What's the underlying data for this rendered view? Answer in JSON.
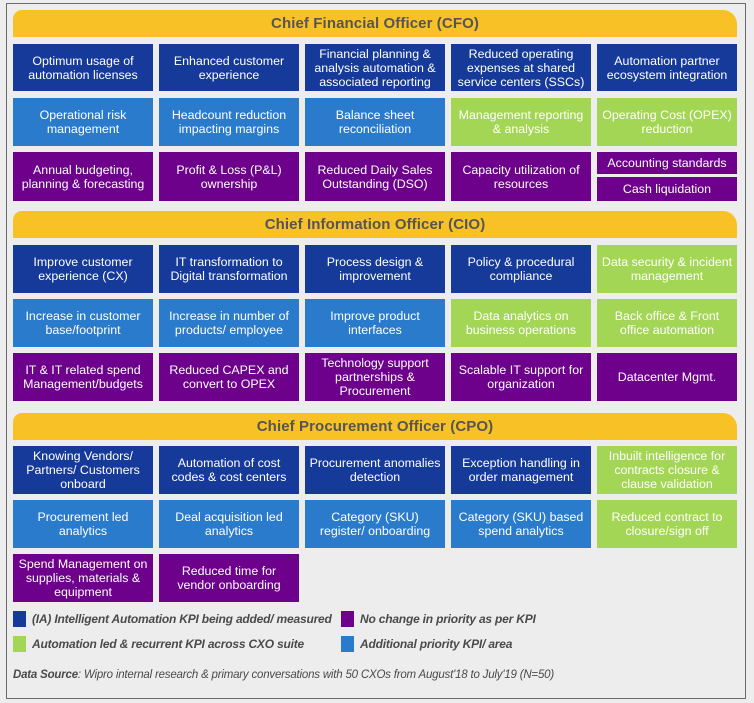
{
  "colors": {
    "header": "#f8c125",
    "ia_kpi": "#163a9a",
    "additional_priority": "#2a7bcc",
    "no_change": "#6d018b",
    "automation_recurrent": "#a4d655"
  },
  "sections": [
    {
      "title": "Chief Financial Officer (CFO)",
      "rows": [
        [
          {
            "label": "Optimum usage of automation licenses",
            "category": "ia_kpi"
          },
          {
            "label": "Enhanced customer experience",
            "category": "ia_kpi"
          },
          {
            "label": "Financial planning & analysis automation & associated reporting",
            "category": "ia_kpi"
          },
          {
            "label": "Reduced operating expenses at shared service centers (SSCs)",
            "category": "ia_kpi"
          },
          {
            "label": "Automation partner ecosystem integration",
            "category": "ia_kpi"
          }
        ],
        [
          {
            "label": "Operational risk management",
            "category": "additional_priority"
          },
          {
            "label": "Headcount reduction impacting margins",
            "category": "additional_priority"
          },
          {
            "label": "Balance sheet reconciliation",
            "category": "additional_priority"
          },
          {
            "label": "Management reporting  & analysis",
            "category": "automation_recurrent"
          },
          {
            "label": "Operating Cost (OPEX) reduction",
            "category": "automation_recurrent"
          }
        ],
        [
          {
            "label": "Annual budgeting, planning & forecasting",
            "category": "no_change"
          },
          {
            "label": "Profit & Loss (P&L) ownership",
            "category": "no_change"
          },
          {
            "label": "Reduced Daily Sales Outstanding (DSO)",
            "category": "no_change"
          },
          {
            "label": "Capacity utilization of resources",
            "category": "no_change"
          },
          {
            "label": "Accounting standards",
            "category": "no_change"
          },
          {
            "label": "Cash liquidation",
            "category": "no_change"
          }
        ]
      ]
    },
    {
      "title": "Chief Information Officer (CIO)",
      "rows": [
        [
          {
            "label": "Improve customer experience (CX)",
            "category": "ia_kpi"
          },
          {
            "label": "IT transformation to Digital transformation",
            "category": "ia_kpi"
          },
          {
            "label": "Process design & improvement",
            "category": "ia_kpi"
          },
          {
            "label": "Policy & procedural compliance",
            "category": "ia_kpi"
          },
          {
            "label": "Data security & incident management",
            "category": "automation_recurrent"
          }
        ],
        [
          {
            "label": "Increase in customer base/footprint",
            "category": "additional_priority"
          },
          {
            "label": "Increase in number of products/ employee",
            "category": "additional_priority"
          },
          {
            "label": "Improve product interfaces",
            "category": "additional_priority"
          },
          {
            "label": "Data analytics on business operations",
            "category": "automation_recurrent"
          },
          {
            "label": "Back office & Front office automation",
            "category": "automation_recurrent"
          }
        ],
        [
          {
            "label": "IT & IT related spend Management/budgets",
            "category": "no_change"
          },
          {
            "label": "Reduced CAPEX and convert to OPEX",
            "category": "no_change"
          },
          {
            "label": "Technology support partnerships & Procurement",
            "category": "no_change"
          },
          {
            "label": "Scalable IT support for organization",
            "category": "no_change"
          },
          {
            "label": "Datacenter Mgmt.",
            "category": "no_change"
          }
        ]
      ]
    },
    {
      "title": "Chief Procurement Officer (CPO)",
      "rows": [
        [
          {
            "label": "Knowing Vendors/ Partners/ Customers onboard",
            "category": "ia_kpi"
          },
          {
            "label": "Automation of cost codes & cost centers",
            "category": "ia_kpi"
          },
          {
            "label": "Procurement anomalies detection",
            "category": "ia_kpi"
          },
          {
            "label": "Exception handling in order management",
            "category": "ia_kpi"
          },
          {
            "label": "Inbuilt intelligence for contracts closure & clause validation",
            "category": "automation_recurrent"
          }
        ],
        [
          {
            "label": "Procurement led analytics",
            "category": "additional_priority"
          },
          {
            "label": "Deal acquisition led analytics",
            "category": "additional_priority"
          },
          {
            "label": "Category (SKU) register/ onboarding",
            "category": "additional_priority"
          },
          {
            "label": "Category (SKU) based spend analytics",
            "category": "additional_priority"
          },
          {
            "label": "Reduced contract to closure/sign off",
            "category": "automation_recurrent"
          }
        ],
        [
          {
            "label": "Spend Management on supplies, materials & equipment",
            "category": "no_change"
          },
          {
            "label": "Reduced time for vendor onboarding",
            "category": "no_change"
          }
        ]
      ]
    }
  ],
  "legend": [
    {
      "label": "(IA) Intelligent Automation KPI being added/ measured",
      "category": "ia_kpi"
    },
    {
      "label": "No change in priority as per KPI",
      "category": "no_change"
    },
    {
      "label": "Automation led & recurrent KPI across CXO suite",
      "category": "automation_recurrent"
    },
    {
      "label": "Additional priority KPI/ area",
      "category": "additional_priority"
    }
  ],
  "source": {
    "label": "Data Source",
    "text": ": Wipro internal research & primary conversations with 50 CXOs from August'18 to July'19 (N=50)"
  }
}
